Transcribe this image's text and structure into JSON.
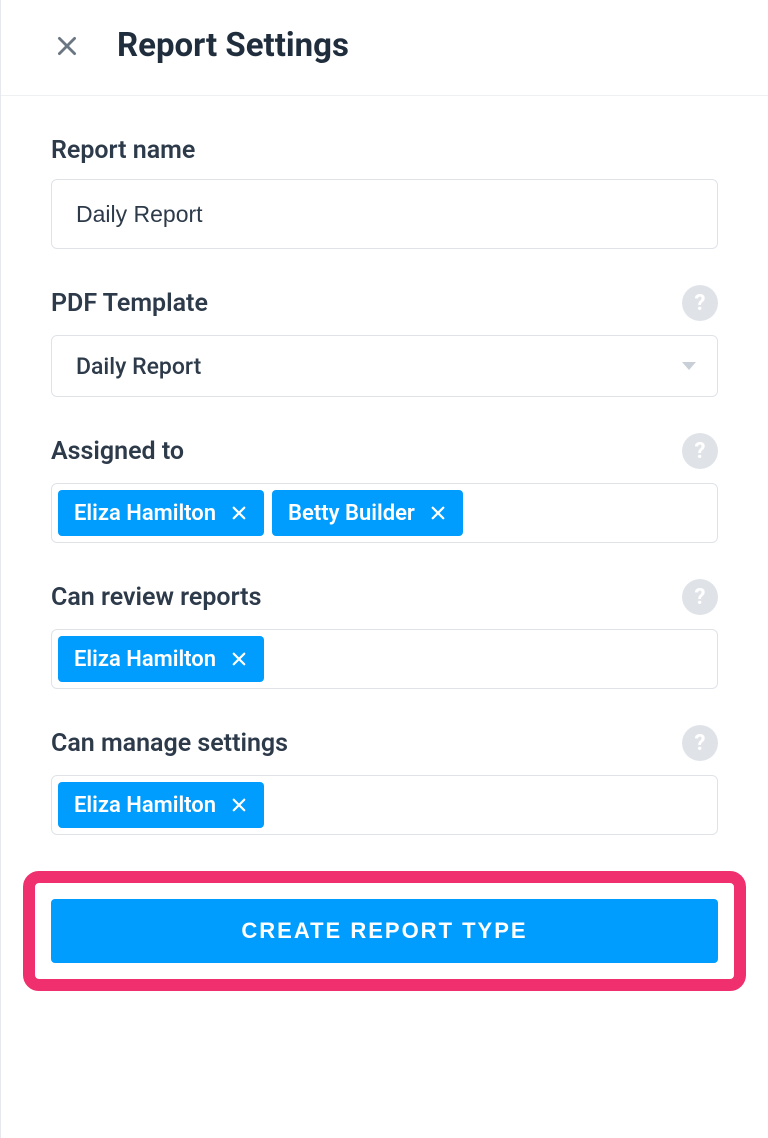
{
  "header": {
    "title": "Report Settings"
  },
  "fields": {
    "report_name": {
      "label": "Report name",
      "value": "Daily Report"
    },
    "pdf_template": {
      "label": "PDF Template",
      "value": "Daily Report"
    },
    "assigned_to": {
      "label": "Assigned to",
      "chips": [
        "Eliza Hamilton",
        "Betty Builder"
      ]
    },
    "can_review": {
      "label": "Can review reports",
      "chips": [
        "Eliza Hamilton"
      ]
    },
    "can_manage": {
      "label": "Can manage settings",
      "chips": [
        "Eliza Hamilton"
      ]
    }
  },
  "help_glyph": "?",
  "submit": {
    "label": "CREATE REPORT TYPE"
  }
}
